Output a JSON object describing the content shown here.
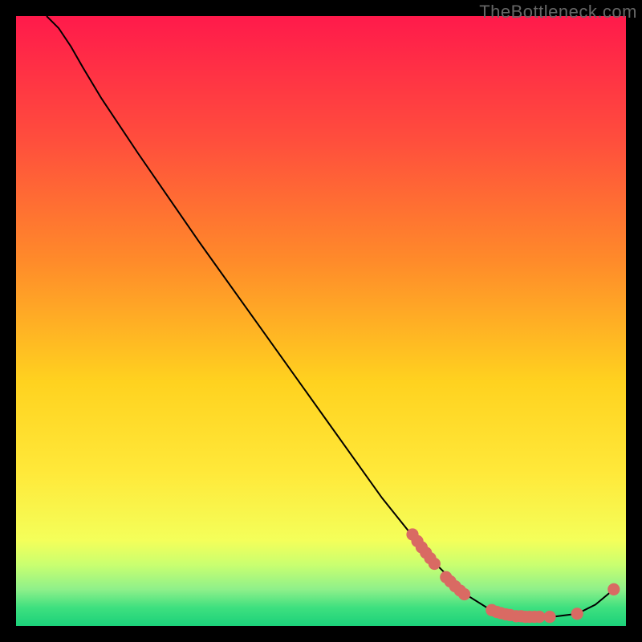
{
  "watermark": "TheBottleneck.com",
  "chart_data": {
    "type": "line",
    "title": "",
    "xlabel": "",
    "ylabel": "",
    "xlim": [
      0,
      100
    ],
    "ylim": [
      0,
      100
    ],
    "gradient_stops": [
      {
        "offset": 0,
        "color": "#ff1a4b"
      },
      {
        "offset": 20,
        "color": "#ff4d3d"
      },
      {
        "offset": 40,
        "color": "#ff8a2a"
      },
      {
        "offset": 60,
        "color": "#ffd21f"
      },
      {
        "offset": 75,
        "color": "#ffe93a"
      },
      {
        "offset": 86,
        "color": "#f4ff5a"
      },
      {
        "offset": 90,
        "color": "#c9ff70"
      },
      {
        "offset": 94,
        "color": "#8ef08a"
      },
      {
        "offset": 97,
        "color": "#3ee07f"
      },
      {
        "offset": 100,
        "color": "#1bd17a"
      }
    ],
    "curve": [
      {
        "x": 5.0,
        "y": 100.0
      },
      {
        "x": 7.0,
        "y": 98.0
      },
      {
        "x": 9.0,
        "y": 95.0
      },
      {
        "x": 11.0,
        "y": 91.5
      },
      {
        "x": 14.0,
        "y": 86.5
      },
      {
        "x": 20.0,
        "y": 77.5
      },
      {
        "x": 30.0,
        "y": 63.0
      },
      {
        "x": 40.0,
        "y": 49.0
      },
      {
        "x": 50.0,
        "y": 35.0
      },
      {
        "x": 60.0,
        "y": 21.0
      },
      {
        "x": 68.0,
        "y": 11.0
      },
      {
        "x": 74.0,
        "y": 5.0
      },
      {
        "x": 78.0,
        "y": 2.5
      },
      {
        "x": 82.0,
        "y": 1.5
      },
      {
        "x": 88.0,
        "y": 1.5
      },
      {
        "x": 92.0,
        "y": 2.0
      },
      {
        "x": 95.0,
        "y": 3.5
      },
      {
        "x": 98.0,
        "y": 6.0
      }
    ],
    "markers": [
      {
        "x": 65.0,
        "y": 15.0
      },
      {
        "x": 65.8,
        "y": 13.9
      },
      {
        "x": 66.5,
        "y": 12.9
      },
      {
        "x": 67.2,
        "y": 12.0
      },
      {
        "x": 67.9,
        "y": 11.1
      },
      {
        "x": 68.6,
        "y": 10.2
      },
      {
        "x": 70.5,
        "y": 8.0
      },
      {
        "x": 71.2,
        "y": 7.3
      },
      {
        "x": 72.0,
        "y": 6.5
      },
      {
        "x": 72.8,
        "y": 5.8
      },
      {
        "x": 73.5,
        "y": 5.2
      },
      {
        "x": 78.0,
        "y": 2.6
      },
      {
        "x": 78.8,
        "y": 2.3
      },
      {
        "x": 79.5,
        "y": 2.1
      },
      {
        "x": 80.3,
        "y": 1.9
      },
      {
        "x": 81.0,
        "y": 1.8
      },
      {
        "x": 82.0,
        "y": 1.6
      },
      {
        "x": 82.8,
        "y": 1.6
      },
      {
        "x": 83.5,
        "y": 1.5
      },
      {
        "x": 84.2,
        "y": 1.5
      },
      {
        "x": 85.0,
        "y": 1.5
      },
      {
        "x": 85.8,
        "y": 1.5
      },
      {
        "x": 87.5,
        "y": 1.5
      },
      {
        "x": 92.0,
        "y": 2.0
      },
      {
        "x": 98.0,
        "y": 6.0
      }
    ],
    "marker_color": "#d96a63",
    "marker_radius": 1.0,
    "line_color": "#000000",
    "line_width": 0.35
  }
}
